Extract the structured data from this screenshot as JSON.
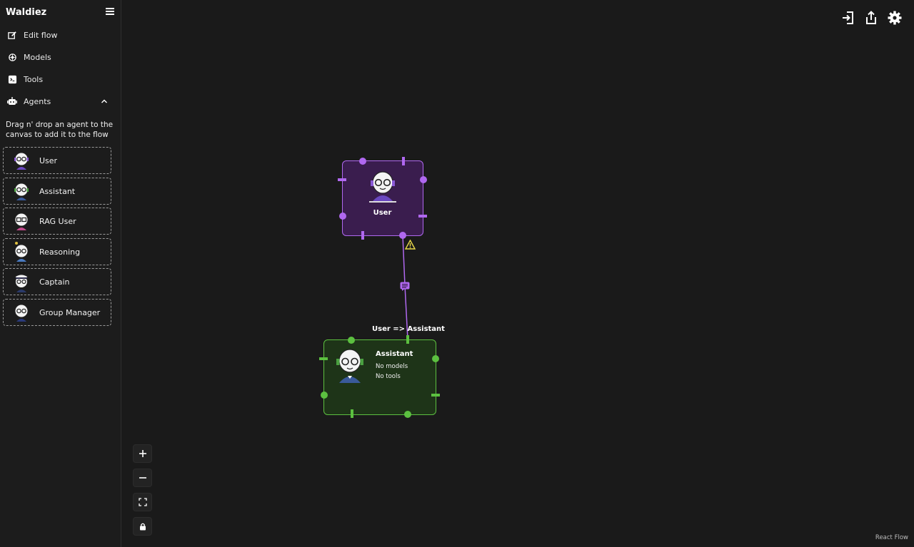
{
  "app": {
    "title": "Waldiez"
  },
  "sidebar": {
    "nav": [
      {
        "label": "Edit flow",
        "icon": "edit-icon"
      },
      {
        "label": "Models",
        "icon": "models-icon"
      },
      {
        "label": "Tools",
        "icon": "terminal-icon"
      },
      {
        "label": "Agents",
        "icon": "robot-icon"
      }
    ],
    "drag_hint": "Drag n' drop an agent to the canvas to add it to the flow",
    "agents": [
      {
        "label": "User"
      },
      {
        "label": "Assistant"
      },
      {
        "label": "RAG User"
      },
      {
        "label": "Reasoning"
      },
      {
        "label": "Captain"
      },
      {
        "label": "Group Manager"
      }
    ]
  },
  "toolbar": {
    "icons": [
      "import-icon",
      "export-icon",
      "settings-icon"
    ]
  },
  "canvas": {
    "nodes": {
      "user": {
        "title": "User",
        "color": "#b068f0"
      },
      "assistant": {
        "title": "Assistant",
        "models": "No models",
        "tools": "No tools",
        "color": "#5cc040"
      }
    },
    "edge": {
      "label": "User => Assistant"
    },
    "warning_icon": "warning-icon",
    "controls": [
      "zoom-in",
      "zoom-out",
      "fit-view",
      "lock"
    ],
    "attribution": "React Flow"
  }
}
